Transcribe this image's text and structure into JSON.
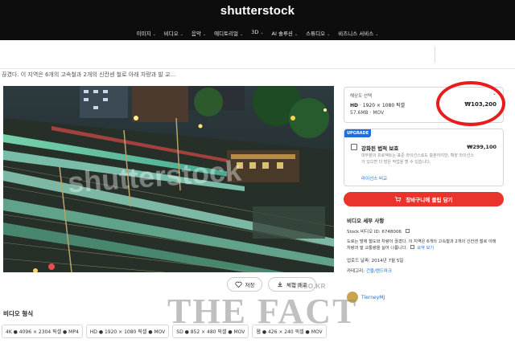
{
  "header": {
    "logo": "shutterstock",
    "nav": [
      {
        "label": "이미지"
      },
      {
        "label": "비디오"
      },
      {
        "label": "음악"
      },
      {
        "label": "에디토리얼"
      },
      {
        "label": "3D"
      },
      {
        "label": "AI 솔루션"
      },
      {
        "label": "스튜디오"
      },
      {
        "label": "비즈니스 서비스"
      }
    ]
  },
  "breadcrumb": "끊겼다. 이 지역은 6개의 고속철과 2개의 신칸센 철로 아래 차량과 발 교...",
  "preview": {
    "watermark": "shutterstock",
    "save_label": "저장",
    "download_label": "체험 배포"
  },
  "formats": {
    "title": "비디오 형식",
    "items": [
      {
        "label": "4K ● 4096 × 2304 픽셀 ● MP4"
      },
      {
        "label": "HD ● 1920 × 1080 픽셀 ● MOV"
      },
      {
        "label": "SD ● 852 × 480 픽셀 ● MOV"
      },
      {
        "label": "웹 ● 426 × 240 픽셀 ● MOV"
      }
    ]
  },
  "pricing": {
    "resolution_label": "해상도 선택",
    "resolution_code": "HD",
    "resolution_dims": "· 1920 × 1080 픽셀",
    "file_info": "57.6MB · MOV",
    "price": "₩103,200"
  },
  "upgrade": {
    "badge": "UPGRADE",
    "title": "강화된 법적 보호",
    "price": "₩299,100",
    "description": "대부분의 프로젝트는 표준 라이선스로도 충분하지만, 확장 라이선스가 있으면 더 많은 작업을 할 수 있습니다.",
    "link": "라이선스 비교"
  },
  "cart": {
    "label": "장바구니에 클립 담기"
  },
  "details": {
    "title": "비디오 세부 사항",
    "stock_id": "Stock 비디오 ID: 6748006",
    "description": "도로는 밤에 철도와 차량이 끊겼다. 이 지역은 6개의 고속철과 2개의 신칸센 철로 아래 차량과 발 교통량을 실어 나릅니다.",
    "more": "요약 보기",
    "upload_date": "업로드 날짜: 2014년 7월 5일",
    "category_label": "카테고리:",
    "category": "건물/랜드마크",
    "contributor": "TierneyMJ"
  },
  "overlay": {
    "small": "TF.CO.KR",
    "big": "THE FACT"
  },
  "colors": {
    "header_bg": "#0d0d0d",
    "cart_red": "#e8342b",
    "annotation_red": "#e81c1c",
    "link_blue": "#1e6fd9"
  },
  "icons": [
    "heart-icon",
    "download-icon",
    "cart-icon",
    "copy-icon",
    "chevron-down-icon",
    "checkbox-icon"
  ]
}
